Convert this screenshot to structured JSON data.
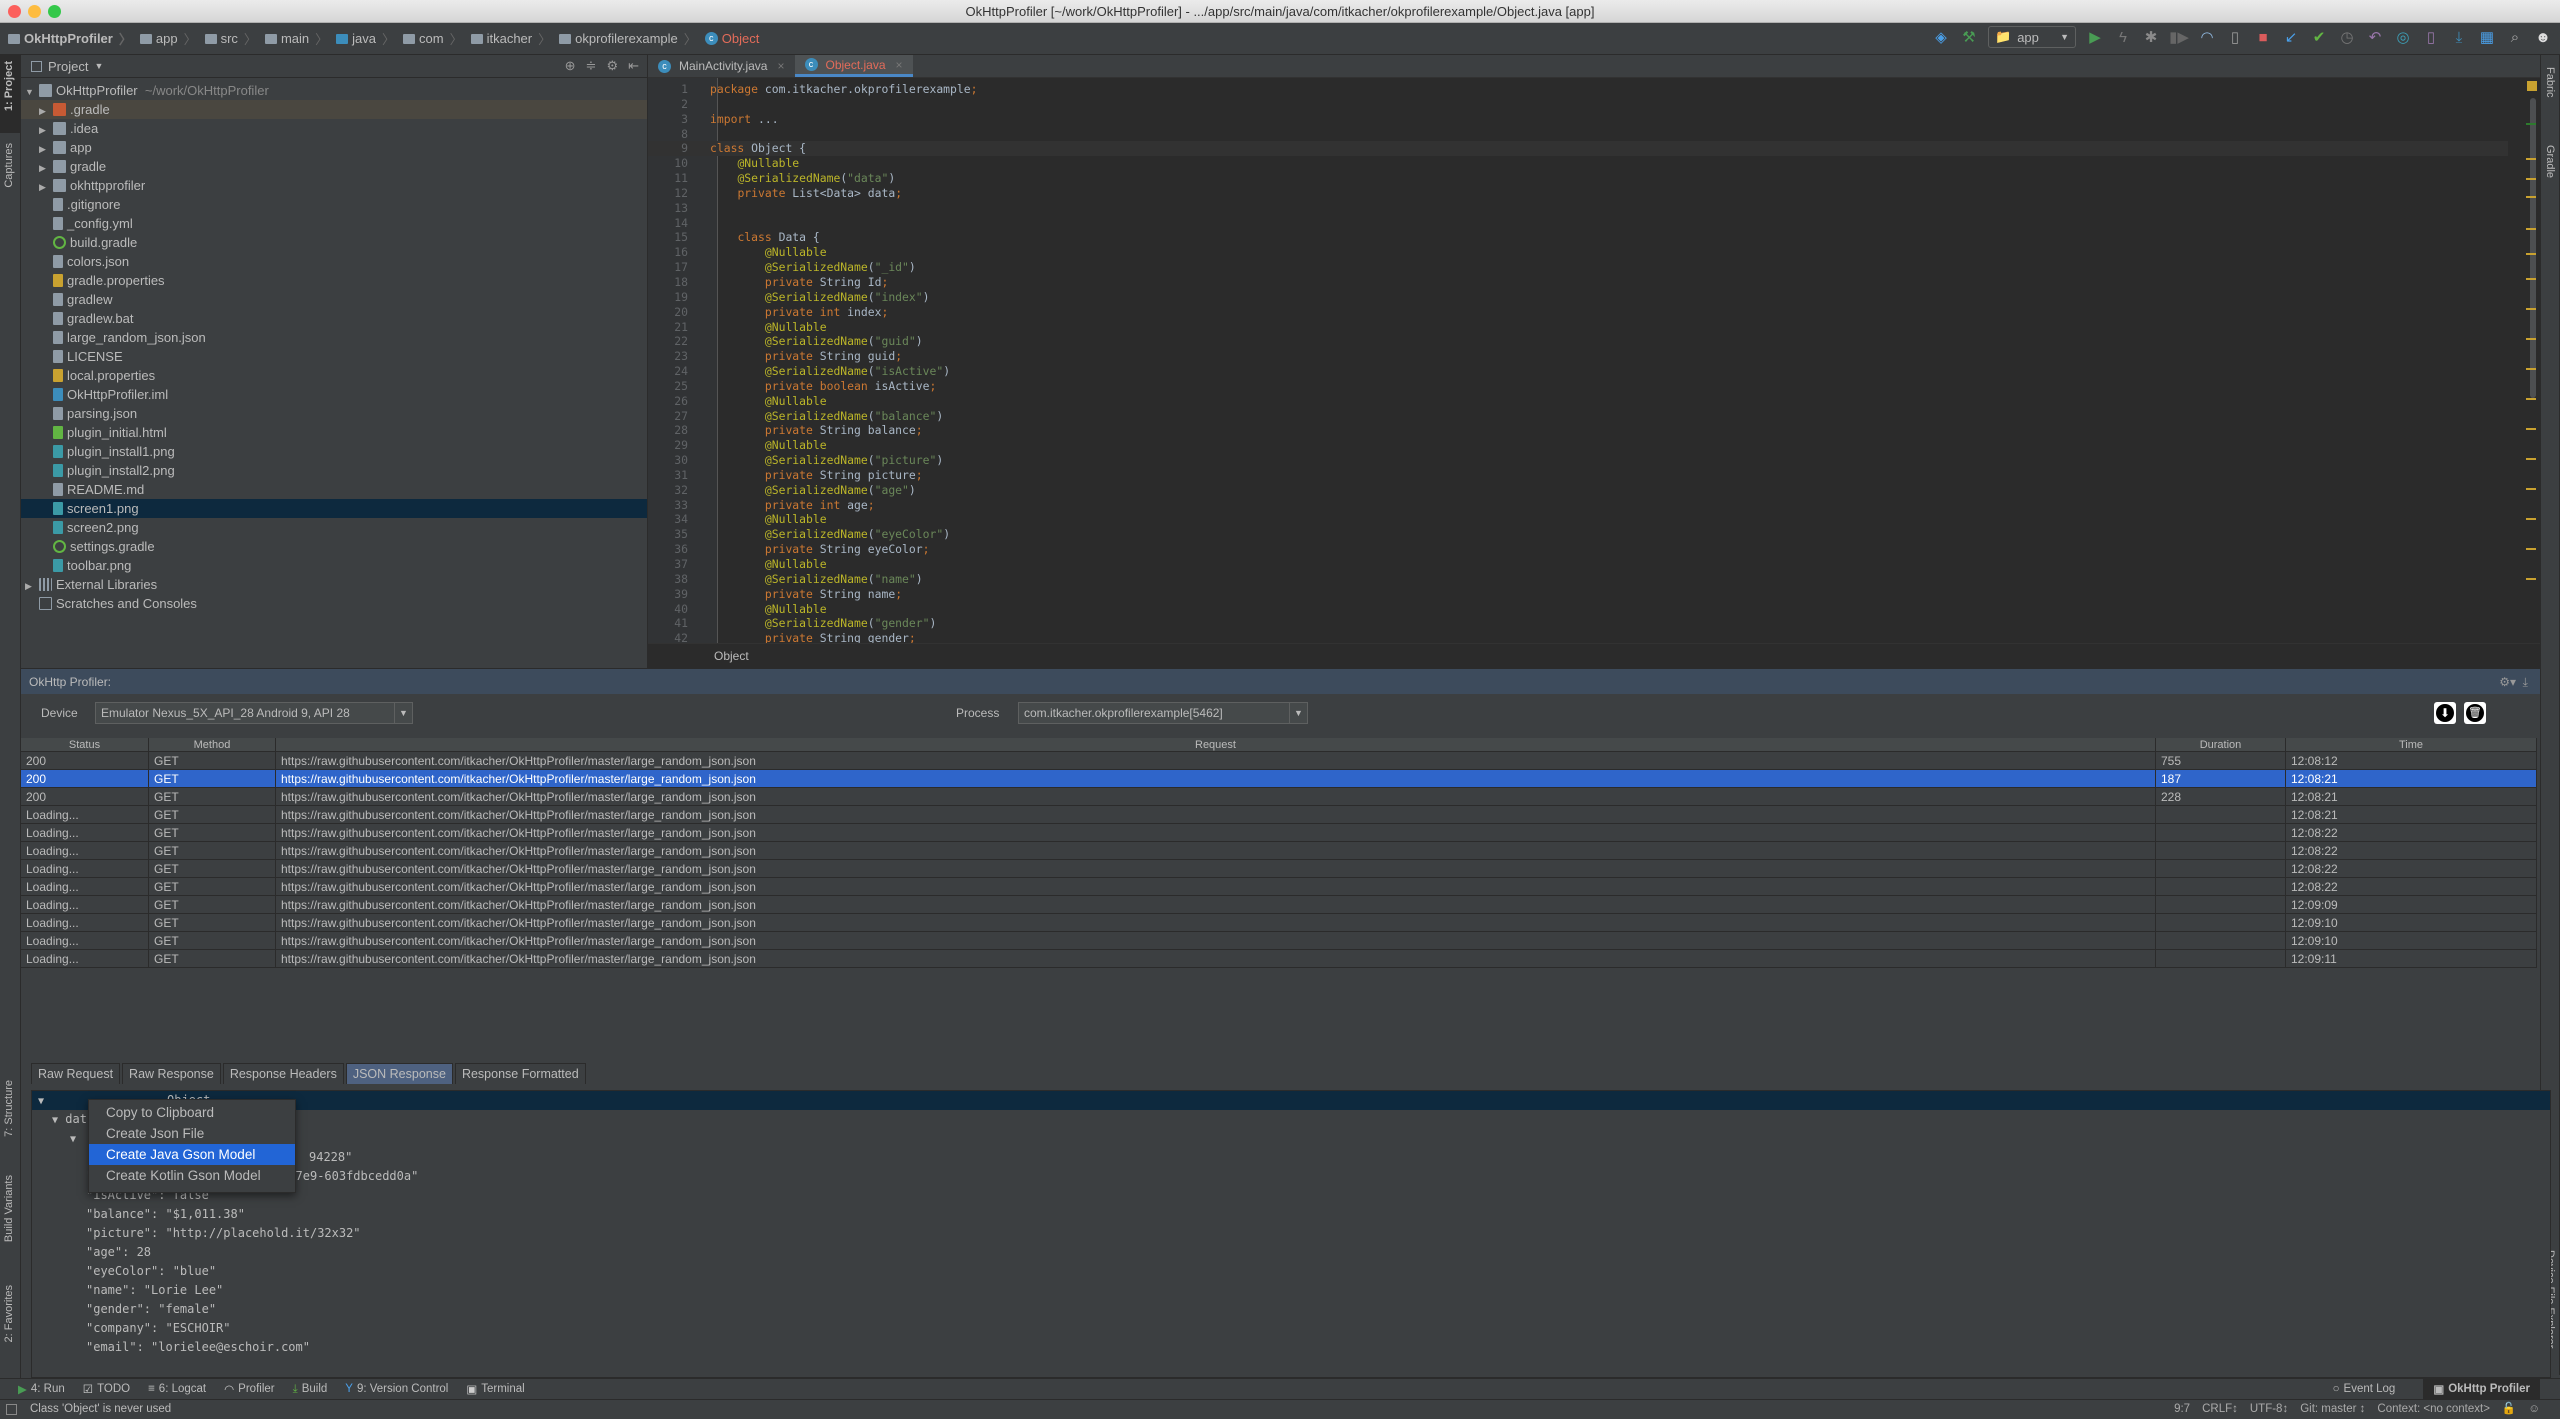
{
  "window": {
    "title": "OkHttpProfiler [~/work/OkHttpProfiler] - .../app/src/main/java/com/itkacher/okprofilerexample/Object.java [app]"
  },
  "breadcrumb": [
    "OkHttpProfiler",
    "app",
    "src",
    "main",
    "java",
    "com",
    "itkacher",
    "okprofilerexample",
    "Object"
  ],
  "toolbar": {
    "run_config": "app",
    "icons": [
      "fabric-icon",
      "build-hammer-icon",
      "run-icon",
      "apply-changes-icon",
      "debug-icon",
      "profile-icon",
      "profiler-gauge-icon",
      "attach-debugger-icon",
      "stop-icon",
      "vcs-update-icon",
      "vcs-commit-icon",
      "vcs-history-icon",
      "vcs-revert-icon",
      "sync-gradle-icon",
      "avd-manager-icon",
      "sdk-manager-icon",
      "project-structure-icon",
      "search-icon",
      "avatar-icon"
    ],
    "accent_stop": "#db5c5c",
    "accent_run": "#499c54"
  },
  "left_strip": {
    "tabs": [
      "1: Project",
      "Captures",
      "7: Structure",
      "Build Variants",
      "2: Favorites"
    ]
  },
  "right_strip": {
    "tabs": [
      "Fabric",
      "Gradle",
      "Device File Explorer"
    ]
  },
  "project": {
    "title": "Project",
    "root": {
      "name": "OkHttpProfiler",
      "path": "~/work/OkHttpProfiler"
    },
    "items": [
      {
        "name": ".gradle",
        "type": "folder-orange",
        "expandable": true,
        "highlight": true
      },
      {
        "name": ".idea",
        "type": "folder",
        "expandable": true
      },
      {
        "name": "app",
        "type": "folder-module",
        "expandable": true
      },
      {
        "name": "gradle",
        "type": "folder",
        "expandable": true
      },
      {
        "name": "okhttpprofiler",
        "type": "folder-lib",
        "expandable": true
      },
      {
        "name": ".gitignore",
        "type": "text"
      },
      {
        "name": "_config.yml",
        "type": "yml"
      },
      {
        "name": "build.gradle",
        "type": "gradle"
      },
      {
        "name": "colors.json",
        "type": "json"
      },
      {
        "name": "gradle.properties",
        "type": "properties"
      },
      {
        "name": "gradlew",
        "type": "text"
      },
      {
        "name": "gradlew.bat",
        "type": "text"
      },
      {
        "name": "large_random_json.json",
        "type": "json"
      },
      {
        "name": "LICENSE",
        "type": "text"
      },
      {
        "name": "local.properties",
        "type": "properties"
      },
      {
        "name": "OkHttpProfiler.iml",
        "type": "iml"
      },
      {
        "name": "parsing.json",
        "type": "json"
      },
      {
        "name": "plugin_initial.html",
        "type": "html"
      },
      {
        "name": "plugin_install1.png",
        "type": "image"
      },
      {
        "name": "plugin_install2.png",
        "type": "image"
      },
      {
        "name": "README.md",
        "type": "text"
      },
      {
        "name": "screen1.png",
        "type": "image",
        "selected": true
      },
      {
        "name": "screen2.png",
        "type": "image"
      },
      {
        "name": "settings.gradle",
        "type": "gradle"
      },
      {
        "name": "toolbar.png",
        "type": "image"
      }
    ],
    "external": "External Libraries",
    "scratches": "Scratches and Consoles"
  },
  "editor": {
    "tabs": [
      {
        "label": "MainActivity.java",
        "active": false
      },
      {
        "label": "Object.java",
        "active": true
      }
    ],
    "lines": [
      {
        "n": "1",
        "t": "package com.itkacher.okprofilerexample;"
      },
      {
        "n": "2",
        "t": ""
      },
      {
        "n": "3",
        "t": "import ..."
      },
      {
        "n": "8",
        "t": ""
      },
      {
        "n": "9",
        "t": "class Object {",
        "cur": true
      },
      {
        "n": "10",
        "t": "    @Nullable"
      },
      {
        "n": "11",
        "t": "    @SerializedName(\"data\")"
      },
      {
        "n": "12",
        "t": "    private List<Data> data;"
      },
      {
        "n": "13",
        "t": ""
      },
      {
        "n": "14",
        "t": ""
      },
      {
        "n": "15",
        "t": "    class Data {"
      },
      {
        "n": "16",
        "t": "        @Nullable"
      },
      {
        "n": "17",
        "t": "        @SerializedName(\"_id\")"
      },
      {
        "n": "18",
        "t": "        private String Id;"
      },
      {
        "n": "19",
        "t": "        @SerializedName(\"index\")"
      },
      {
        "n": "20",
        "t": "        private int index;"
      },
      {
        "n": "21",
        "t": "        @Nullable"
      },
      {
        "n": "22",
        "t": "        @SerializedName(\"guid\")"
      },
      {
        "n": "23",
        "t": "        private String guid;"
      },
      {
        "n": "24",
        "t": "        @SerializedName(\"isActive\")"
      },
      {
        "n": "25",
        "t": "        private boolean isActive;"
      },
      {
        "n": "26",
        "t": "        @Nullable"
      },
      {
        "n": "27",
        "t": "        @SerializedName(\"balance\")"
      },
      {
        "n": "28",
        "t": "        private String balance;"
      },
      {
        "n": "29",
        "t": "        @Nullable"
      },
      {
        "n": "30",
        "t": "        @SerializedName(\"picture\")"
      },
      {
        "n": "31",
        "t": "        private String picture;"
      },
      {
        "n": "32",
        "t": "        @SerializedName(\"age\")"
      },
      {
        "n": "33",
        "t": "        private int age;"
      },
      {
        "n": "34",
        "t": "        @Nullable"
      },
      {
        "n": "35",
        "t": "        @SerializedName(\"eyeColor\")"
      },
      {
        "n": "36",
        "t": "        private String eyeColor;"
      },
      {
        "n": "37",
        "t": "        @Nullable"
      },
      {
        "n": "38",
        "t": "        @SerializedName(\"name\")"
      },
      {
        "n": "39",
        "t": "        private String name;"
      },
      {
        "n": "40",
        "t": "        @Nullable"
      },
      {
        "n": "41",
        "t": "        @SerializedName(\"gender\")"
      },
      {
        "n": "42",
        "t": "        private String gender;"
      }
    ],
    "breadcrumb": "Object"
  },
  "profiler": {
    "title": "OkHttp Profiler:",
    "device_label": "Device",
    "device_value": "Emulator Nexus_5X_API_28 Android 9, API 28",
    "process_label": "Process",
    "process_value": "com.itkacher.okprofilerexample[5462]",
    "columns": [
      "Status",
      "Method",
      "Request",
      "Duration",
      "Time"
    ],
    "rows": [
      {
        "status": "200",
        "method": "GET",
        "url": "https://raw.githubusercontent.com/itkacher/OkHttpProfiler/master/large_random_json.json",
        "duration": "755",
        "time": "12:08:12"
      },
      {
        "status": "200",
        "method": "GET",
        "url": "https://raw.githubusercontent.com/itkacher/OkHttpProfiler/master/large_random_json.json",
        "duration": "187",
        "time": "12:08:21",
        "selected": true
      },
      {
        "status": "200",
        "method": "GET",
        "url": "https://raw.githubusercontent.com/itkacher/OkHttpProfiler/master/large_random_json.json",
        "duration": "228",
        "time": "12:08:21"
      },
      {
        "status": "Loading...",
        "method": "GET",
        "url": "https://raw.githubusercontent.com/itkacher/OkHttpProfiler/master/large_random_json.json",
        "duration": "",
        "time": "12:08:21"
      },
      {
        "status": "Loading...",
        "method": "GET",
        "url": "https://raw.githubusercontent.com/itkacher/OkHttpProfiler/master/large_random_json.json",
        "duration": "",
        "time": "12:08:22"
      },
      {
        "status": "Loading...",
        "method": "GET",
        "url": "https://raw.githubusercontent.com/itkacher/OkHttpProfiler/master/large_random_json.json",
        "duration": "",
        "time": "12:08:22"
      },
      {
        "status": "Loading...",
        "method": "GET",
        "url": "https://raw.githubusercontent.com/itkacher/OkHttpProfiler/master/large_random_json.json",
        "duration": "",
        "time": "12:08:22"
      },
      {
        "status": "Loading...",
        "method": "GET",
        "url": "https://raw.githubusercontent.com/itkacher/OkHttpProfiler/master/large_random_json.json",
        "duration": "",
        "time": "12:08:22"
      },
      {
        "status": "Loading...",
        "method": "GET",
        "url": "https://raw.githubusercontent.com/itkacher/OkHttpProfiler/master/large_random_json.json",
        "duration": "",
        "time": "12:09:09"
      },
      {
        "status": "Loading...",
        "method": "GET",
        "url": "https://raw.githubusercontent.com/itkacher/OkHttpProfiler/master/large_random_json.json",
        "duration": "",
        "time": "12:09:10"
      },
      {
        "status": "Loading...",
        "method": "GET",
        "url": "https://raw.githubusercontent.com/itkacher/OkHttpProfiler/master/large_random_json.json",
        "duration": "",
        "time": "12:09:10"
      },
      {
        "status": "Loading...",
        "method": "GET",
        "url": "https://raw.githubusercontent.com/itkacher/OkHttpProfiler/master/large_random_json.json",
        "duration": "",
        "time": "12:09:11"
      }
    ],
    "response_tabs": [
      {
        "label": "Raw Request"
      },
      {
        "label": "Raw Response"
      },
      {
        "label": "Response Headers"
      },
      {
        "label": "JSON Response",
        "active": true
      },
      {
        "label": "Response Formatted"
      }
    ],
    "json_tree": {
      "root": "Object",
      "data_node": "dat",
      "id_fragment": "94228\"",
      "lines": [
        "\"guid\": \"8a231d1c-7b38-4a4d-a7e9-603fdbcedd0a\"",
        "\"isActive\": false",
        "\"balance\": \"$1,011.38\"",
        "\"picture\": \"http://placehold.it/32x32\"",
        "\"age\": 28",
        "\"eyeColor\": \"blue\"",
        "\"name\": \"Lorie Lee\"",
        "\"gender\": \"female\"",
        "\"company\": \"ESCHOIR\"",
        "\"email\": \"lorielee@eschoir.com\""
      ]
    },
    "context_menu": [
      "Copy to Clipboard",
      "Create Json File",
      "Create Java Gson Model",
      "Create Kotlin Gson Model"
    ],
    "context_menu_selected": 2
  },
  "bottom_tools": [
    {
      "label": "4: Run",
      "icon": "run-icon"
    },
    {
      "label": "TODO",
      "icon": "todo-icon"
    },
    {
      "label": "6: Logcat",
      "icon": "logcat-icon"
    },
    {
      "label": "Profiler",
      "icon": "profiler-icon"
    },
    {
      "label": "Build",
      "icon": "build-icon"
    },
    {
      "label": "9: Version Control",
      "icon": "version-control-icon"
    },
    {
      "label": "Terminal",
      "icon": "terminal-icon"
    }
  ],
  "bottom_right_tools": [
    {
      "label": "Event Log"
    },
    {
      "label": "OkHttp Profiler",
      "active": true
    }
  ],
  "status": {
    "message": "Class 'Object' is never used",
    "position": "9:7",
    "line_sep": "CRLF↕",
    "encoding": "UTF-8↕",
    "git": "Git: master ↕",
    "context": "Context: <no context>"
  }
}
